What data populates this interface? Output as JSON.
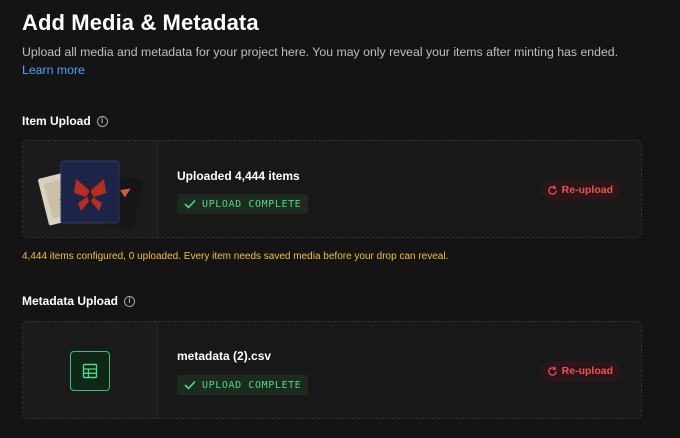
{
  "header": {
    "title": "Add Media & Metadata",
    "description": "Upload all media and metadata for your project here. You may only reveal your items after minting has ended.",
    "learn_more": "Learn more"
  },
  "item_upload": {
    "label": "Item Upload",
    "title": "Uploaded 4,444 items",
    "status": "UPLOAD COMPLETE",
    "reupload": "Re-upload",
    "warning": "4,444 items configured, 0 uploaded. Every item needs saved media before your drop can reveal."
  },
  "metadata_upload": {
    "label": "Metadata Upload",
    "filename": "metadata (2).csv",
    "status": "UPLOAD COMPLETE",
    "reupload": "Re-upload"
  },
  "colors": {
    "background": "#141414",
    "success": "#4ade80",
    "danger": "#f05252",
    "warning": "#f2c12e",
    "link": "#4da3ff"
  },
  "icons": [
    "info-icon",
    "check-icon",
    "refresh-icon",
    "table-icon"
  ]
}
